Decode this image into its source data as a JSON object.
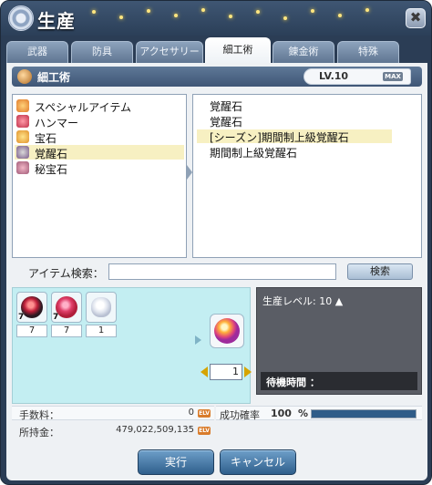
{
  "window": {
    "title": "生産",
    "close_label": "✖"
  },
  "tabs": [
    {
      "label": "武器"
    },
    {
      "label": "防具"
    },
    {
      "label": "アクセサリー"
    },
    {
      "label": "細工術"
    },
    {
      "label": "錬金術"
    },
    {
      "label": "特殊"
    }
  ],
  "active_tab": "細工術",
  "section": {
    "title": "細工術",
    "level": "LV.10",
    "max_badge": "MAX"
  },
  "categories": [
    {
      "label": "スペシャルアイテム",
      "icon": "star-icon"
    },
    {
      "label": "ハンマー",
      "icon": "hammer-icon"
    },
    {
      "label": "宝石",
      "icon": "gem-icon"
    },
    {
      "label": "覚醒石",
      "icon": "awakening-stone-icon",
      "selected": true
    },
    {
      "label": "秘宝石",
      "icon": "secret-gem-icon"
    }
  ],
  "results": [
    {
      "label": "覚醒石"
    },
    {
      "label": "覚醒石"
    },
    {
      "label": "[シーズン]期間制上級覚醒石",
      "selected": true
    },
    {
      "label": "期間制上級覚醒石"
    }
  ],
  "search": {
    "label": "アイテム検索：",
    "value": "",
    "button": "検索"
  },
  "materials": [
    {
      "icon": "dark-crystal-icon",
      "badge": "7",
      "count": "7"
    },
    {
      "icon": "pink-crystal-icon",
      "badge": "7",
      "count": "7"
    },
    {
      "icon": "white-item-icon",
      "badge": "",
      "count": "1"
    }
  ],
  "result_item": {
    "icon": "awakening-stone-icon",
    "quantity": "1"
  },
  "info": {
    "level_label": "生産レベル: 10 ▲",
    "wait_label": "待機時間 ："
  },
  "fee": {
    "label": "手数料：",
    "value": "0",
    "currency": "ELV"
  },
  "success": {
    "label": "成功確率",
    "value": "100",
    "unit": "%",
    "fraction": 1.0
  },
  "money": {
    "label": "所持金：",
    "value": "479,022,509,135",
    "currency": "ELV"
  },
  "buttons": {
    "execute": "実行",
    "cancel": "キャンセル"
  },
  "colors": {
    "accent": "#2f5f8c",
    "selected_row": "#f7f0c2",
    "material_bg": "#c3eef2"
  }
}
